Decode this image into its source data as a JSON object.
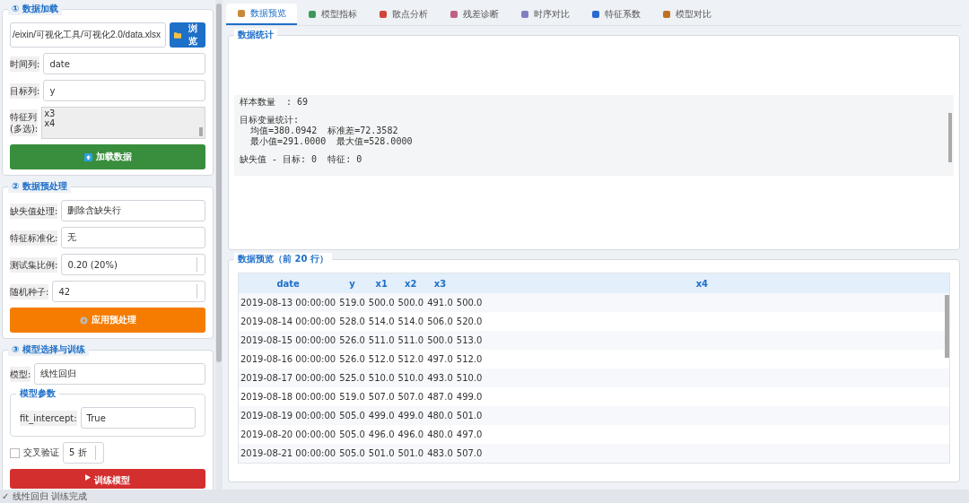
{
  "sections": [
    {
      "title": "① 数据加载",
      "file_path": "/eixin/可视化工具/可视化2.0/data.xlsx",
      "browse_button": "浏览",
      "fields": [
        {
          "label": "时间列:",
          "value": "date"
        },
        {
          "label": "目标列:",
          "value": "y"
        }
      ],
      "feature_label": "特征列\n(多选):",
      "features": [
        "x3",
        "x4"
      ],
      "button": "加载数据"
    },
    {
      "title": "② 数据预处理",
      "fields": [
        {
          "label": "缺失值处理:",
          "value": "删除含缺失行",
          "kind": "combo"
        },
        {
          "label": "特征标准化:",
          "value": "无",
          "kind": "combo"
        },
        {
          "label": "测试集比例:",
          "value": "0.20  (20%)",
          "kind": "spin"
        },
        {
          "label": "随机种子:",
          "value": "42",
          "kind": "spin"
        }
      ],
      "button": "应用预处理"
    },
    {
      "title": "③ 模型选择与训练",
      "model_label": "模型:",
      "model": "线性回归",
      "params_title": "模型参数",
      "param_label": "fit_intercept:",
      "param_value": "True",
      "cv_label": "交叉验证",
      "cv_checked": false,
      "cv_folds": "5 折",
      "button": "训练模型"
    }
  ],
  "tabs": [
    {
      "label": "数据预览",
      "selected": true
    },
    {
      "label": "模型指标",
      "selected": false
    },
    {
      "label": "散点分析",
      "selected": false
    },
    {
      "label": "残差诊断",
      "selected": false
    },
    {
      "label": "时序对比",
      "selected": false
    },
    {
      "label": "特征系数",
      "selected": false
    },
    {
      "label": "模型对比",
      "selected": false
    }
  ],
  "stats": {
    "title": "数据统计",
    "paragraphs": [
      [
        "样本数量  : 69"
      ],
      [
        "目标变量统计:",
        "  均值=380.0942  标准差=72.3582",
        "  最小值=291.0000  最大值=528.0000"
      ],
      [
        "缺失值 - 目标: 0  特征: 0"
      ]
    ]
  },
  "preview": {
    "title": "数据预览（前 20 行）",
    "columns": [
      "date",
      "y",
      "x1",
      "x2",
      "x3",
      "x4"
    ],
    "rows": [
      [
        "2019-08-13 00:00:00",
        "519.0",
        "500.0",
        "500.0",
        "491.0",
        "500.0"
      ],
      [
        "2019-08-14 00:00:00",
        "528.0",
        "514.0",
        "514.0",
        "506.0",
        "520.0"
      ],
      [
        "2019-08-15 00:00:00",
        "526.0",
        "511.0",
        "511.0",
        "500.0",
        "513.0"
      ],
      [
        "2019-08-16 00:00:00",
        "526.0",
        "512.0",
        "512.0",
        "497.0",
        "512.0"
      ],
      [
        "2019-08-17 00:00:00",
        "525.0",
        "510.0",
        "510.0",
        "493.0",
        "510.0"
      ],
      [
        "2019-08-18 00:00:00",
        "519.0",
        "507.0",
        "507.0",
        "487.0",
        "499.0"
      ],
      [
        "2019-08-19 00:00:00",
        "505.0",
        "499.0",
        "499.0",
        "480.0",
        "501.0"
      ],
      [
        "2019-08-20 00:00:00",
        "505.0",
        "496.0",
        "496.0",
        "480.0",
        "497.0"
      ],
      [
        "2019-08-21 00:00:00",
        "505.0",
        "501.0",
        "501.0",
        "483.0",
        "507.0"
      ]
    ]
  },
  "status_bar": "✓ 线性回归 训练完成"
}
